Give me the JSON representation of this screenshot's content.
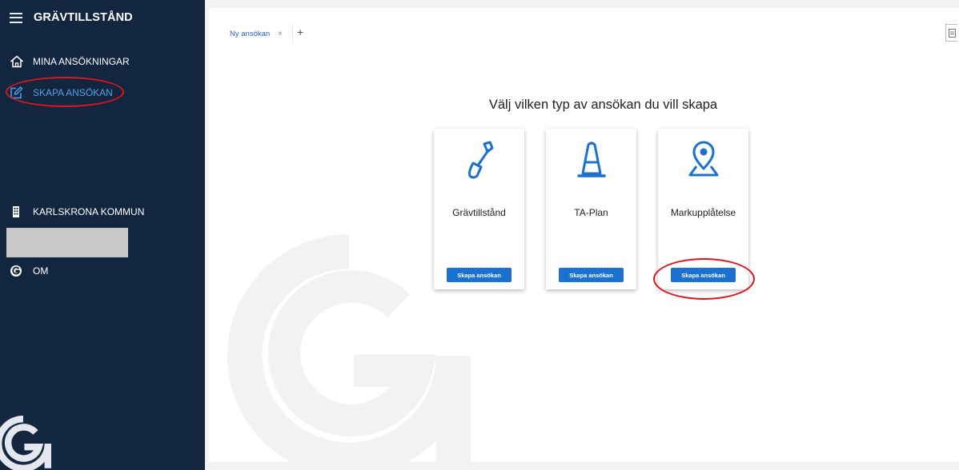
{
  "app": {
    "title": "GRÄVTILLSTÅND"
  },
  "sidebar": {
    "items": [
      {
        "label": "MINA ANSÖKNINGAR",
        "icon": "home-icon"
      },
      {
        "label": "SKAPA ANSÖKAN",
        "icon": "edit-icon",
        "active": true
      },
      {
        "label": "KARLSKRONA KOMMUN",
        "icon": "building-icon"
      },
      {
        "label": "OM",
        "icon": "logo-g-icon"
      }
    ]
  },
  "tabs": [
    {
      "label": "Ny ansökan",
      "close": "×"
    }
  ],
  "tab_add": "+",
  "main": {
    "heading": "Välj vilken typ av ansökan du vill skapa",
    "cards": [
      {
        "label": "Grävtillstånd",
        "icon": "shovel-icon",
        "button": "Skapa ansökan"
      },
      {
        "label": "TA-Plan",
        "icon": "traffic-cone-icon",
        "button": "Skapa ansökan"
      },
      {
        "label": "Markupplåtelse",
        "icon": "map-pin-icon",
        "button": "Skapa ansökan"
      }
    ]
  },
  "colors": {
    "sidebar_bg": "#13263f",
    "accent": "#1b71d1",
    "highlight": "#e0141b",
    "active_nav": "#4fa3e8"
  }
}
